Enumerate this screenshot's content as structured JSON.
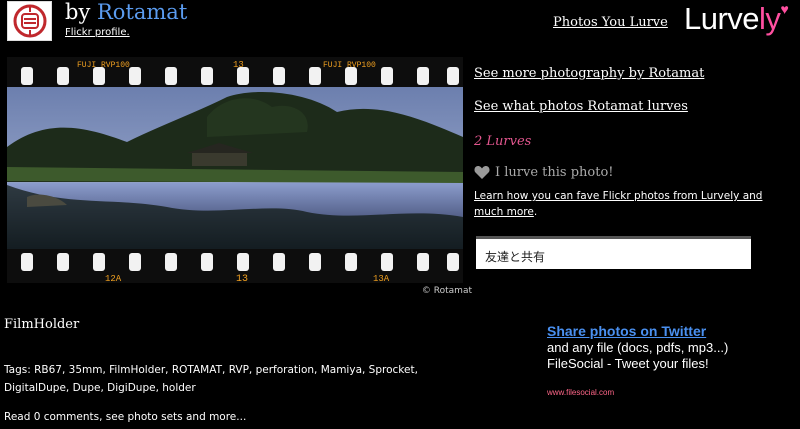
{
  "header": {
    "by_prefix": "by ",
    "owner_name": "Rotamat",
    "flickr_profile_label": "Flickr profile",
    "flickr_profile_suffix": ".",
    "nav_photos_you_lurve": "Photos You Lurve",
    "logo_main": "Lurve",
    "logo_accent": "ly",
    "logo_heart": "♥"
  },
  "photo": {
    "film_marks": {
      "left_top": "FUJI RVP100",
      "center_top": "13",
      "right_top": "FUJI RVP100",
      "left_bottom": "12A",
      "center_bottom": "13",
      "right_bottom": "13A"
    },
    "credit": "© Rotamat"
  },
  "sidebar": {
    "see_more": "See more photography by Rotamat",
    "see_lurves": "See what photos Rotamat lurves",
    "lurve_count": "2 Lurves",
    "lurve_button": "I lurve this photo!",
    "learn_link": "Learn how you can fave Flickr photos from Lurvely and much more",
    "learn_suffix": ".",
    "share_label": "友達と共有"
  },
  "details": {
    "title": "FilmHolder",
    "tags": "Tags: RB67, 35mm, FilmHolder, ROTAMAT, RVP, perforation, Mamiya, Sprocket, DigitalDupe, Dupe, DigiDupe, holder",
    "read_more": "Read 0 comments, see photo sets and more..."
  },
  "ad": {
    "title": "Share photos on Twitter",
    "body": "and any file (docs, pdfs, mp3...) FileSocial - Tweet your files!",
    "url": "www.filesocial.com"
  },
  "colors": {
    "background": "#000000",
    "owner_name": "#5b9cf0",
    "lurve_count": "#e2568e",
    "logo_accent": "#ff4fa0",
    "ad_title": "#4a90f0"
  }
}
